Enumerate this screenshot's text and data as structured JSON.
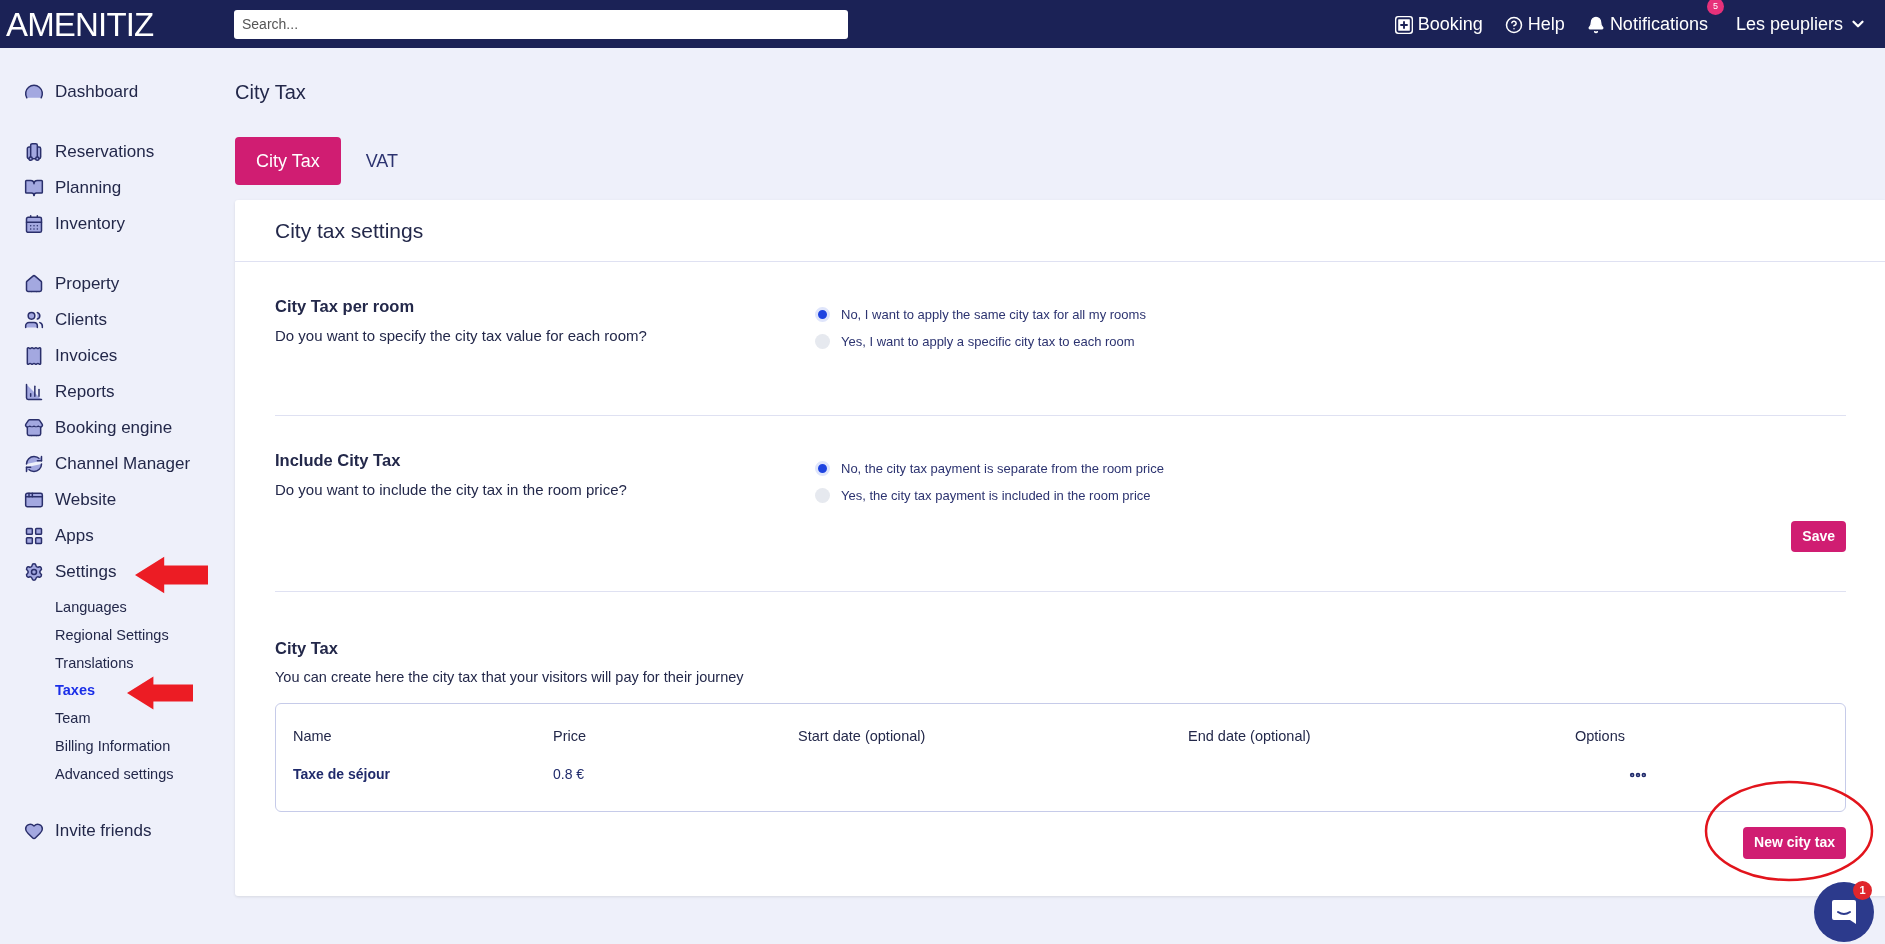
{
  "top_bar": {
    "logo": "AMENITIZ",
    "search": {
      "placeholder": "Search..."
    },
    "actions": [
      {
        "kind": "booking",
        "label": "Booking"
      },
      {
        "kind": "help",
        "label": "Help"
      },
      {
        "kind": "notifications",
        "label": "Notifications",
        "badge": "5"
      }
    ],
    "account": "Les peupliers"
  },
  "sidebar": {
    "groups": [
      [
        {
          "kind": "dashboard",
          "label": "Dashboard"
        }
      ],
      [
        {
          "kind": "reservations",
          "label": "Reservations"
        },
        {
          "kind": "planning",
          "label": "Planning"
        },
        {
          "kind": "inventory",
          "label": "Inventory"
        }
      ],
      [
        {
          "kind": "property",
          "label": "Property"
        },
        {
          "kind": "clients",
          "label": "Clients"
        },
        {
          "kind": "invoices",
          "label": "Invoices"
        },
        {
          "kind": "reports",
          "label": "Reports"
        },
        {
          "kind": "booking_engine",
          "label": "Booking engine"
        },
        {
          "kind": "channel_manager",
          "label": "Channel Manager"
        },
        {
          "kind": "website",
          "label": "Website"
        },
        {
          "kind": "apps",
          "label": "Apps"
        },
        {
          "kind": "settings",
          "label": "Settings",
          "children": [
            {
              "label": "Languages",
              "selected": false
            },
            {
              "label": "Regional Settings",
              "selected": false
            },
            {
              "label": "Translations",
              "selected": false
            },
            {
              "label": "Taxes",
              "selected": true
            },
            {
              "label": "Team",
              "selected": false
            },
            {
              "label": "Billing Information",
              "selected": false
            },
            {
              "label": "Advanced settings",
              "selected": false
            }
          ]
        }
      ],
      [
        {
          "kind": "invite",
          "label": "Invite friends"
        }
      ]
    ]
  },
  "page_title": "City Tax",
  "tabs": [
    {
      "label": "City Tax",
      "selected": true
    },
    {
      "label": "VAT",
      "selected": false
    }
  ],
  "card": {
    "title": "City tax settings",
    "settings": [
      {
        "title": "City Tax per room",
        "description": "Do you want to specify the city tax value for each room?",
        "options": [
          {
            "label": "No, I want to apply the same city tax for all my rooms",
            "selected": true
          },
          {
            "label": "Yes, I want to apply a specific city tax to each room",
            "selected": false
          }
        ]
      },
      {
        "title": "Include City Tax",
        "description": "Do you want to include the city tax in the room price?",
        "options": [
          {
            "label": "No, the city tax payment is separate from the room price",
            "selected": true
          },
          {
            "label": "Yes, the city tax payment is included in the room price",
            "selected": false
          }
        ]
      }
    ],
    "save_button": "Save",
    "city_tax": {
      "title": "City Tax",
      "description": "You can create here the city tax that your visitors will pay for their journey",
      "table": {
        "columns": [
          "Name",
          "Price",
          "Start date (optional)",
          "End date (optional)",
          "Options"
        ],
        "rows": [
          {
            "name": "Taxe de séjour",
            "price": "0.8 €"
          }
        ]
      },
      "new_button": "New city tax"
    }
  },
  "chat": {
    "badge": "1"
  }
}
